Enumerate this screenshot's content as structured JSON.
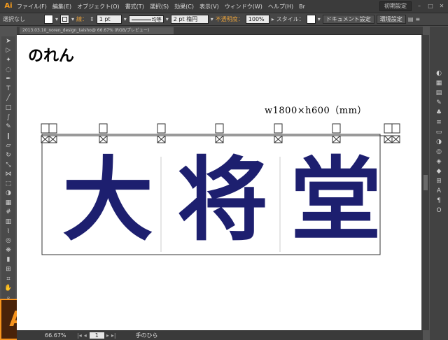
{
  "app": {
    "logo_small": "Ai",
    "logo_large": "Ai"
  },
  "menu": {
    "items": [
      "ファイル(F)",
      "編集(E)",
      "オブジェクト(O)",
      "書式(T)",
      "選択(S)",
      "効果(C)",
      "表示(V)",
      "ウィンドウ(W)",
      "ヘルプ(H)"
    ],
    "workspace": "初期設定",
    "window_controls": [
      "minimize",
      "maximize",
      "close"
    ]
  },
  "control_bar": {
    "selection": "選択なし",
    "stroke_label": "線：",
    "stroke_weight": "1 pt",
    "uniform": "均等",
    "brush": "2 pt 楕円",
    "opacity_label": "不透明度：",
    "opacity": "100%",
    "style_label": "スタイル：",
    "doc_settings": "ドキュメント設定",
    "env_settings": "環境設定"
  },
  "document": {
    "tab_title": "2013.03.10_noren_design_taisho@ 66.67% (RGB/プレビュー)"
  },
  "artboard": {
    "title": "のれん",
    "dimensions": "w1800×h600（mm）",
    "noren_text": [
      "大",
      "将",
      "堂"
    ],
    "text_color": "#1d1f6f"
  },
  "status_bar": {
    "zoom": "66.67%",
    "page": "1",
    "tool": "手のひら"
  },
  "tools": [
    "selection-icon",
    "direct-selection-icon",
    "magic-wand-icon",
    "lasso-icon",
    "pen-icon",
    "type-icon",
    "line-icon",
    "rectangle-icon",
    "paintbrush-icon",
    "pencil-icon",
    "blob-brush-icon",
    "eraser-icon",
    "rotate-icon",
    "scale-icon",
    "width-icon",
    "free-transform-icon",
    "shape-builder-icon",
    "perspective-icon",
    "mesh-icon",
    "gradient-icon",
    "eyedropper-icon",
    "blend-icon",
    "symbol-sprayer-icon",
    "column-graph-icon",
    "artboard-icon",
    "slice-icon",
    "hand-icon",
    "zoom-icon"
  ],
  "panel_icons": [
    "color-icon",
    "color-guide-icon",
    "swatches-icon",
    "brushes-icon",
    "symbols-icon",
    "stroke-icon",
    "gradient-panel-icon",
    "transparency-icon",
    "appearance-icon",
    "graphic-styles-icon",
    "layers-icon",
    "artboards-icon",
    "character-icon",
    "paragraph-icon",
    "opentype-icon"
  ]
}
